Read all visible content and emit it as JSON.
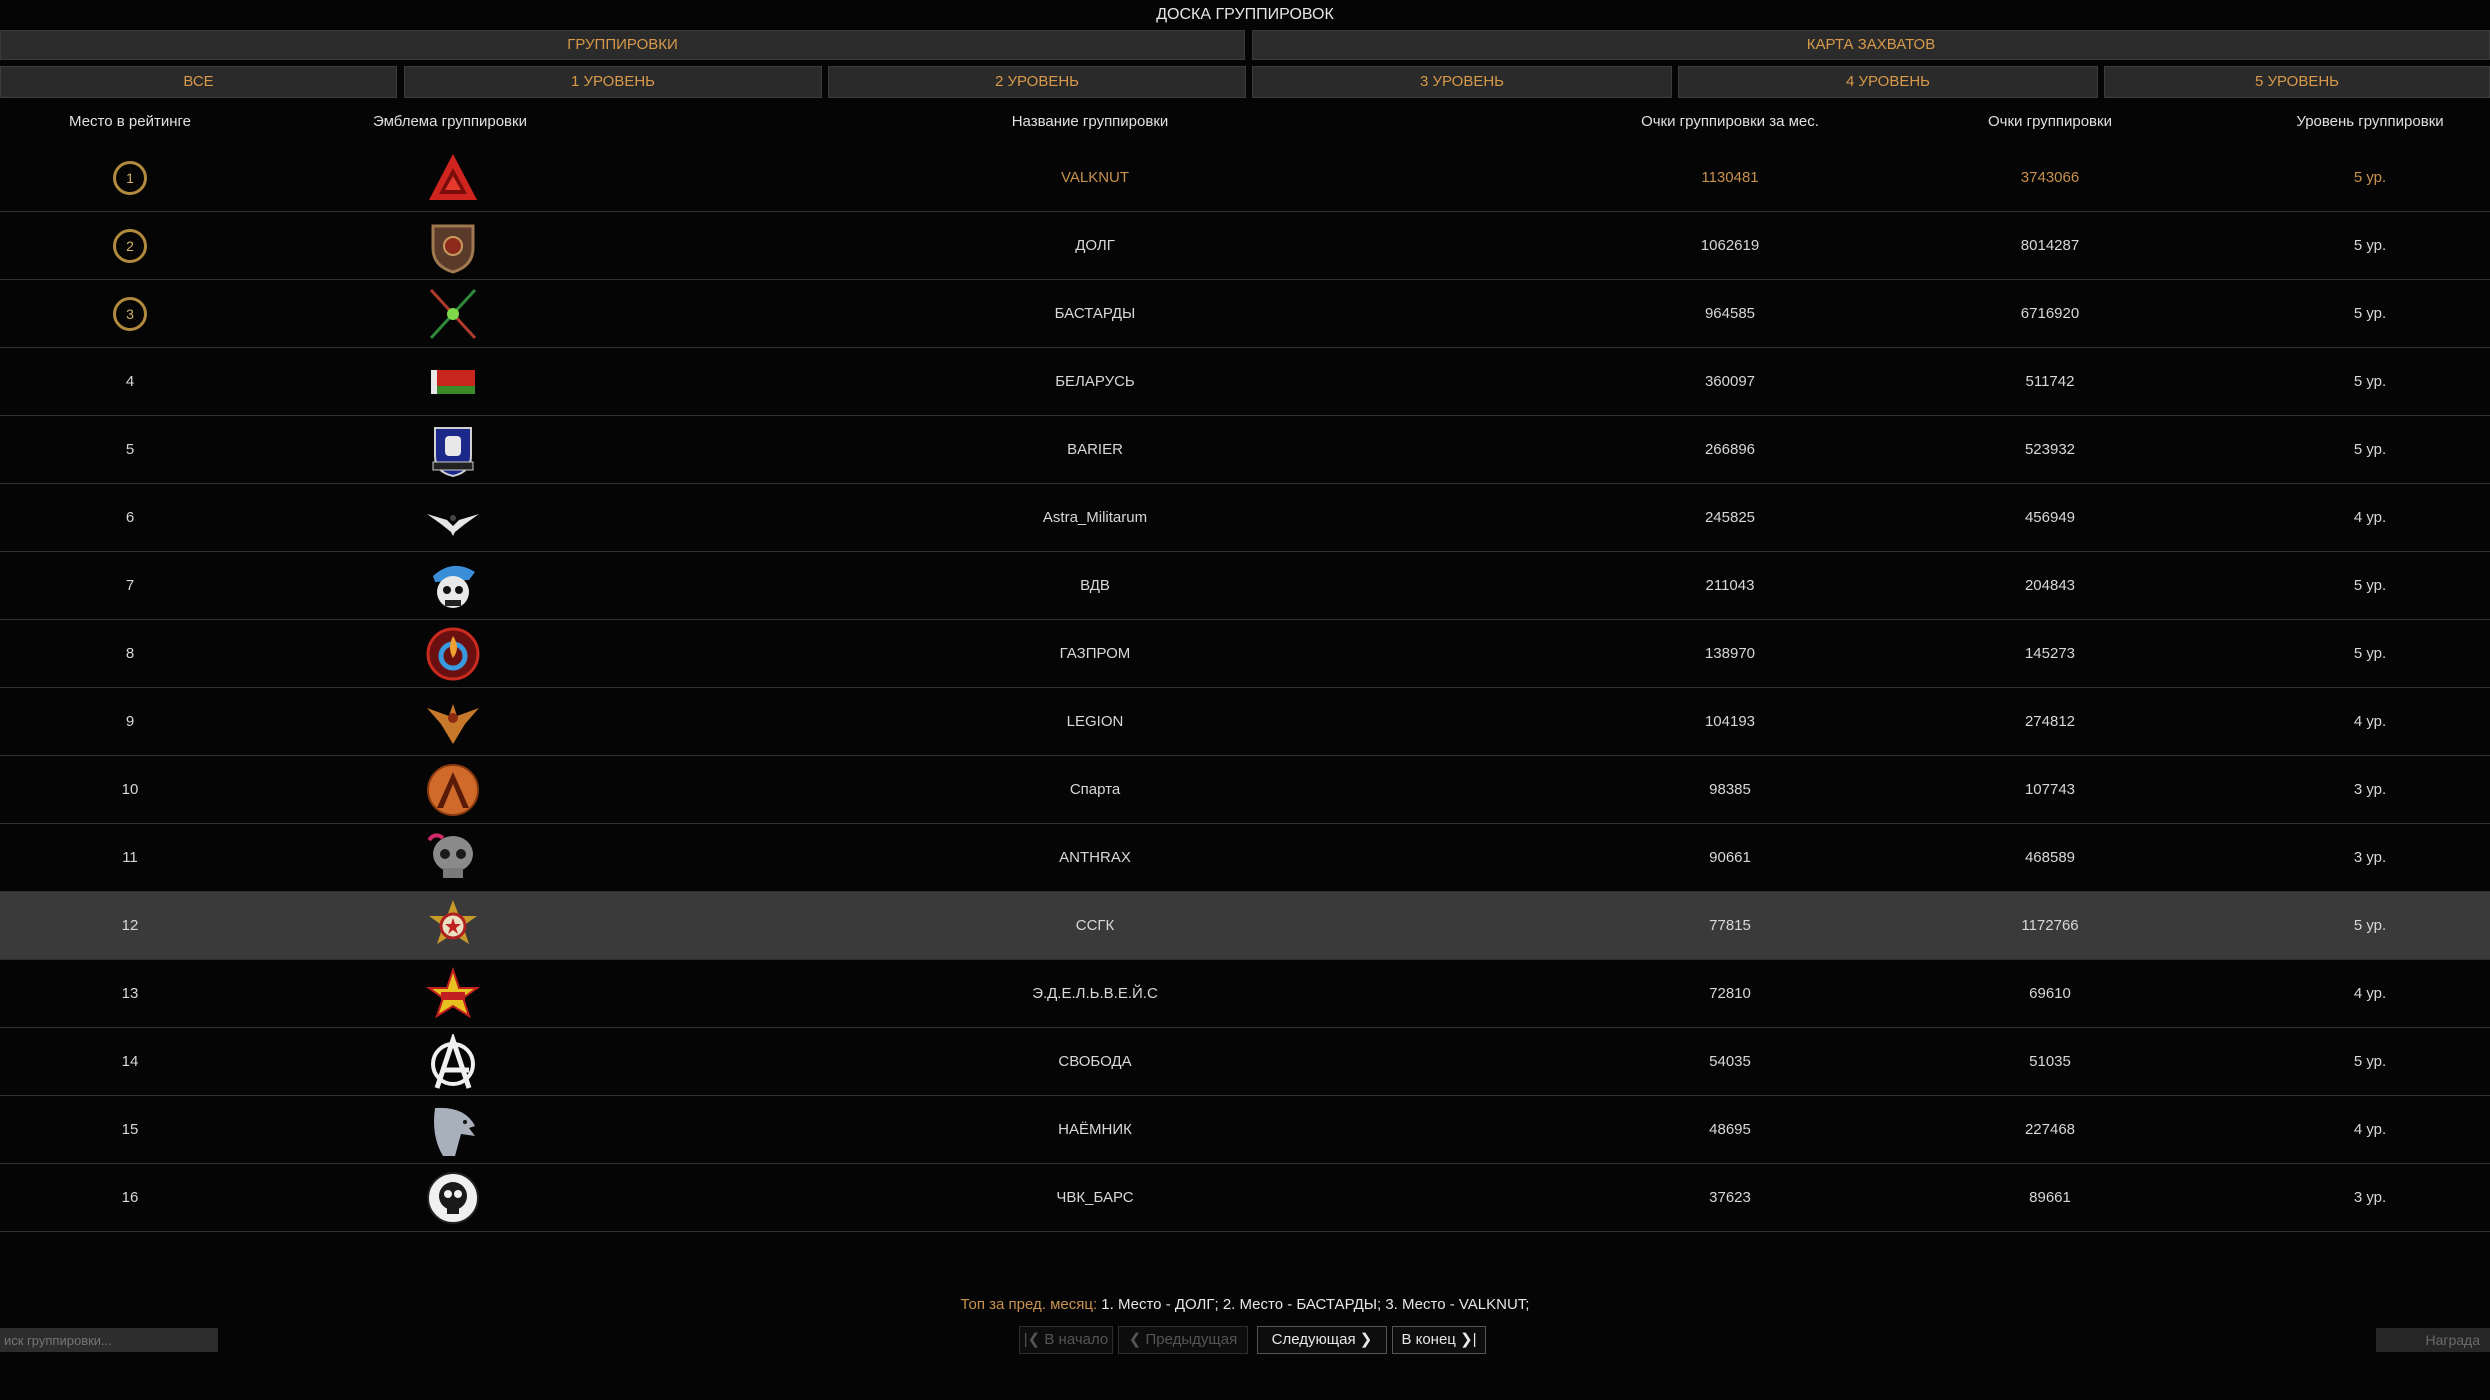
{
  "header": {
    "title": "ДОСКА ГРУППИРОВОК"
  },
  "topbar": {
    "left": "ГРУППИРОВКИ",
    "right": "КАРТА ЗАХВАТОВ"
  },
  "tabs": [
    "ВСЕ",
    "1 УРОВЕНЬ",
    "2 УРОВЕНЬ",
    "3 УРОВЕНЬ",
    "4 УРОВЕНЬ",
    "5 УРОВЕНЬ"
  ],
  "columns": {
    "rank": "Место в рейтинге",
    "emblem": "Эмблема группировки",
    "name": "Название группировки",
    "month": "Очки группировки за мес.",
    "points": "Очки группировки",
    "level": "Уровень группировки"
  },
  "rows": [
    {
      "rank": "1",
      "emblem": "valknut-icon",
      "name": "VALKNUT",
      "month": "1130481",
      "points": "3743066",
      "level": "5 ур."
    },
    {
      "rank": "2",
      "emblem": "shield-icon",
      "name": "ДОЛГ",
      "month": "1062619",
      "points": "8014287",
      "level": "5 ур."
    },
    {
      "rank": "3",
      "emblem": "crossed-swords-icon",
      "name": "БАСТАРДЫ",
      "month": "964585",
      "points": "6716920",
      "level": "5 ур."
    },
    {
      "rank": "4",
      "emblem": "flag-icon",
      "name": "БЕЛАРУСЬ",
      "month": "360097",
      "points": "511742",
      "level": "5 ур."
    },
    {
      "rank": "5",
      "emblem": "fist-badge-icon",
      "name": "BARIER",
      "month": "266896",
      "points": "523932",
      "level": "5 ур."
    },
    {
      "rank": "6",
      "emblem": "eagle-icon",
      "name": "Astra_Militarum",
      "month": "245825",
      "points": "456949",
      "level": "4 ур."
    },
    {
      "rank": "7",
      "emblem": "skull-beret-icon",
      "name": "ВДВ",
      "month": "211043",
      "points": "204843",
      "level": "5 ур."
    },
    {
      "rank": "8",
      "emblem": "flame-icon",
      "name": "ГАЗПРОМ",
      "month": "138970",
      "points": "145273",
      "level": "5 ур."
    },
    {
      "rank": "9",
      "emblem": "winged-emblem-icon",
      "name": "LEGION",
      "month": "104193",
      "points": "274812",
      "level": "4 ур."
    },
    {
      "rank": "10",
      "emblem": "lambda-shield-icon",
      "name": "Спарта",
      "month": "98385",
      "points": "107743",
      "level": "3 ур."
    },
    {
      "rank": "11",
      "emblem": "skull-icon",
      "name": "ANTHRAX",
      "month": "90661",
      "points": "468589",
      "level": "3 ур."
    },
    {
      "rank": "12",
      "emblem": "guard-badge-icon",
      "name": "ССГК",
      "month": "77815",
      "points": "1172766",
      "level": "5 ур.",
      "selected": true
    },
    {
      "rank": "13",
      "emblem": "star-icon",
      "name": "Э.Д.Е.Л.Ь.В.Е.Й.С",
      "month": "72810",
      "points": "69610",
      "level": "4 ур."
    },
    {
      "rank": "14",
      "emblem": "anarchy-icon",
      "name": "СВОБОДА",
      "month": "54035",
      "points": "51035",
      "level": "5 ур."
    },
    {
      "rank": "15",
      "emblem": "eagle-head-icon",
      "name": "НАЁМНИК",
      "month": "48695",
      "points": "227468",
      "level": "4 ур."
    },
    {
      "rank": "16",
      "emblem": "skull-badge-icon",
      "name": "ЧВК_БАРС",
      "month": "37623",
      "points": "89661",
      "level": "3 ур."
    }
  ],
  "footer": {
    "top_label": "Топ за пред. месяц:",
    "top_text": "1. Место - ДОЛГ; 2. Место - БАСТАРДЫ; 3. Место - VALKNUT;",
    "btn_start": "В начало",
    "btn_prev": "Предыдущая",
    "btn_next": "Следующая",
    "btn_end": "В конец",
    "search_placeholder": "иск группировки...",
    "reward": "Награда"
  },
  "colors": {
    "accent": "#c8914f",
    "background": "#050505",
    "selected_row": "#3a3a3a"
  }
}
